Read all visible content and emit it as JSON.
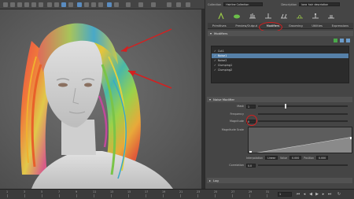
{
  "header": {
    "collection_label": "Collection",
    "collection_value": "Hairline Collection",
    "description_label": "Description",
    "description_value": "long_hair_description"
  },
  "tabs": [
    "Primitives",
    "Preview/Output",
    "Modifiers",
    "Grooming",
    "Utilities",
    "Expressions"
  ],
  "modifiers_section": {
    "title": "Modifiers",
    "items": [
      {
        "label": "Cut1",
        "checked": true,
        "selected": false
      },
      {
        "label": "Noise1",
        "checked": true,
        "selected": true
      },
      {
        "label": "Noise2",
        "checked": true,
        "selected": false
      },
      {
        "label": "Clumping1",
        "checked": true,
        "selected": false
      },
      {
        "label": "Clumping2",
        "checked": true,
        "selected": false
      }
    ]
  },
  "noise_section": {
    "title": "Noise Modifier",
    "attrs": [
      {
        "label": "Mask",
        "value": "1",
        "fill": 0.3
      },
      {
        "label": "Frequency",
        "value": "",
        "fill": 0
      },
      {
        "label": "Magnitude",
        "value": "0",
        "fill": 0
      }
    ],
    "magnitude_scale_label": "Magnitude Scale",
    "interp_label": "Interpolation",
    "interp_value": "Linear",
    "value_label": "Value",
    "value_value": "0.000",
    "position_label": "Position",
    "position_value": "0.000",
    "correlation_label": "Correlation",
    "correlation_value": "0.0"
  },
  "log_section": {
    "title": "Log"
  },
  "timeline": {
    "ticks": [
      "1",
      "3",
      "5",
      "7",
      "9",
      "11",
      "13",
      "15",
      "17",
      "19",
      "21",
      "23",
      "25",
      "27",
      "29",
      "31"
    ],
    "current_frame": "1"
  },
  "annotations": {
    "circle_color": "#d42020",
    "arrow_color": "#d42020"
  },
  "colors": {
    "selection": "#5680a8",
    "accent": "#5a8cc0"
  }
}
